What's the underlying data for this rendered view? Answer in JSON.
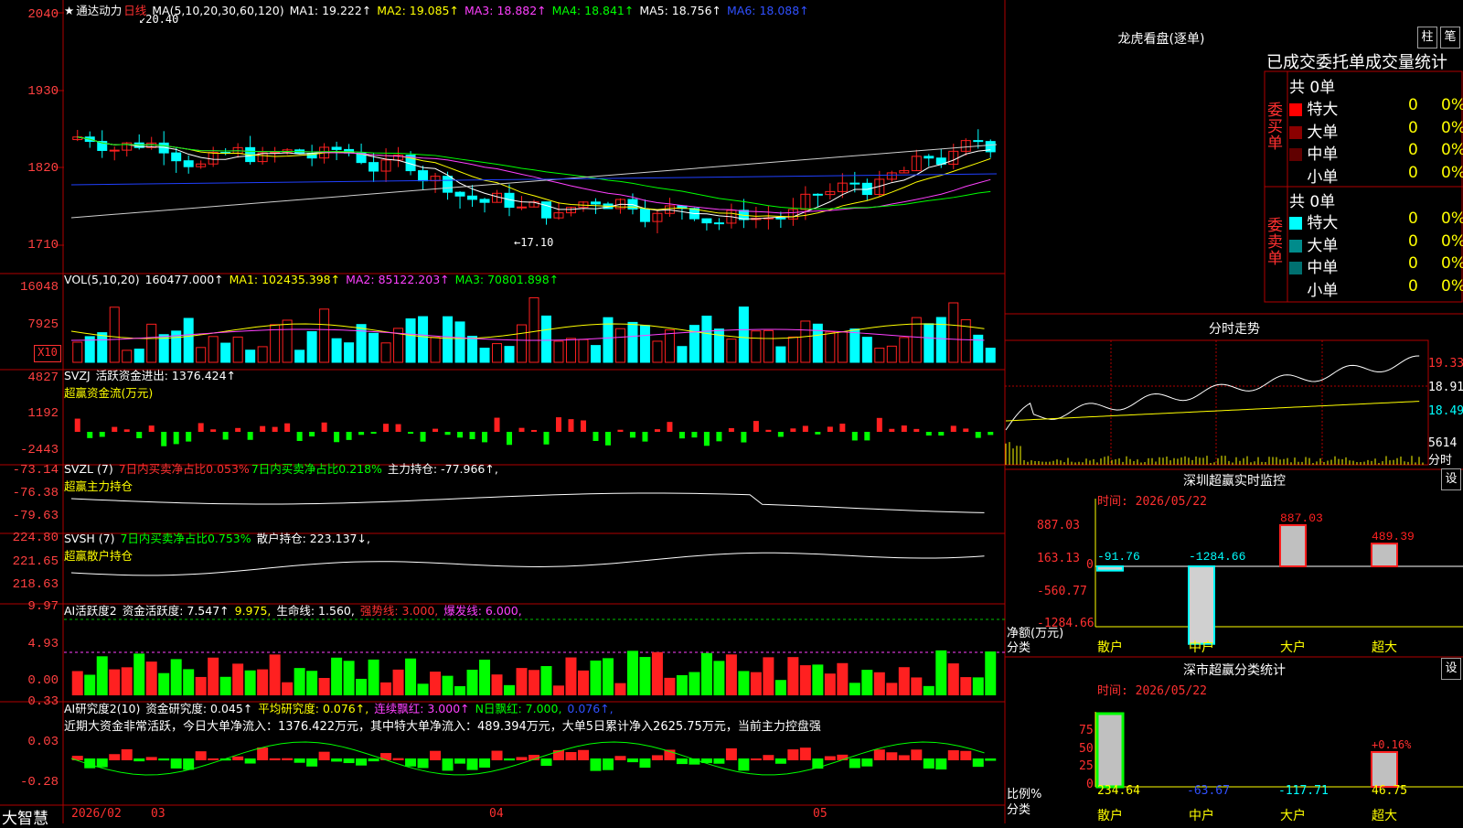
{
  "stock": {
    "star": "★",
    "name": "通达动力",
    "period": "日线"
  },
  "ma_header": {
    "label": "MA(5,10,20,30,60,120)",
    "ma1": "MA1: 19.222↑",
    "ma2": "MA2: 19.085↑",
    "ma3": "MA3: 18.882↑",
    "ma4": "MA4: 18.841↑",
    "ma5": "MA5: 18.756↑",
    "ma6": "MA6: 18.088↑"
  },
  "price_axis": [
    "2040",
    "1930",
    "1820",
    "1710"
  ],
  "price_annotations": {
    "high": "20.40",
    "low": "17.10"
  },
  "vol_header": {
    "label": "VOL(5,10,20)",
    "vol": "160477.000↑",
    "ma1": "MA1: 102435.398↑",
    "ma2": "MA2: 85122.203↑",
    "ma3": "MA3: 70801.898↑"
  },
  "vol_axis": [
    "16048",
    "7925"
  ],
  "vol_unit": "X10",
  "svzj_header": {
    "label": "SVZJ",
    "text": "活跃资金进出: 1376.424↑",
    "sub": "超赢资金流(万元)"
  },
  "svzj_axis": [
    "4827",
    "1192",
    "-2443"
  ],
  "svzl_header": {
    "label": "SVZL (7)",
    "a": "7日内买卖净占比0.053%",
    "b": "7日内买卖净占比0.218%",
    "c": "主力持仓: -77.966↑,",
    "sub": "超赢主力持仓"
  },
  "svzl_axis": [
    "-73.14",
    "-76.38",
    "-79.63"
  ],
  "svsh_header": {
    "label": "SVSH (7)",
    "a": "7日内买卖净占比0.753%",
    "b": "散户持仓: 223.137↓,",
    "sub": "超赢散户持仓"
  },
  "svsh_axis": [
    "224.80",
    "221.65",
    "218.63"
  ],
  "ai1_header": {
    "label": "AI活跃度2",
    "a": "资金活跃度: 7.547↑",
    "b": "9.975,",
    "c": "生命线: 1.560,",
    "d": "强势线: 3.000,",
    "e": "爆发线: 6.000,"
  },
  "ai1_axis": [
    "9.97",
    "4.93",
    "0.00"
  ],
  "ai2_header": {
    "label": "AI研究度2(10)",
    "a": "资金研究度: 0.045↑",
    "b": "平均研究度: 0.076↑,",
    "c": "连续飘红: 3.000↑",
    "d": "N日飘红: 7.000,",
    "e": "0.076↑,"
  },
  "ai2_text": "近期大资金非常活跃，今日大单净流入：1376.422万元，其中特大单净流入：489.394万元，大单5日累计净入2625.75万元，当前主力控盘强",
  "ai2_axis": [
    "0.33",
    "0.03",
    "-0.28"
  ],
  "date_axis": {
    "brand": "大智慧",
    "d1": "2026/02",
    "d2": "03",
    "d3": "04",
    "d4": "05"
  },
  "dragon": {
    "title": "龙虎看盘(逐单)",
    "btn1": "柱",
    "btn2": "笔",
    "subtitle": "已成交委托单成交量统计",
    "buy_label": "委买单",
    "sell_label": "委卖单",
    "buy_total": "共 0单",
    "sell_total": "共 0单",
    "buy_rows": [
      {
        "name": "特大",
        "v": "0",
        "p": "0%",
        "color": "#ff0000"
      },
      {
        "name": "大单",
        "v": "0",
        "p": "0%",
        "color": "#8b0000"
      },
      {
        "name": "中单",
        "v": "0",
        "p": "0%",
        "color": "#600000"
      },
      {
        "name": "小单",
        "v": "0",
        "p": "0%",
        "color": "#000000"
      }
    ],
    "sell_rows": [
      {
        "name": "特大",
        "v": "0",
        "p": "0%",
        "color": "#00ffff"
      },
      {
        "name": "大单",
        "v": "0",
        "p": "0%",
        "color": "#008b8b"
      },
      {
        "name": "中单",
        "v": "0",
        "p": "0%",
        "color": "#007070"
      },
      {
        "name": "小单",
        "v": "0",
        "p": "0%",
        "color": "#000000"
      }
    ]
  },
  "minute": {
    "title": "分时走势",
    "p1": "19.33",
    "p2": "18.91",
    "p3": "18.49",
    "vol": "5614",
    "unit": "分时"
  },
  "monitor": {
    "title": "深圳超赢实时监控",
    "btn": "设",
    "time": "时间: 2026/05/22",
    "axis": [
      "887.03",
      "163.13",
      "0",
      "-560.77",
      "-1284.66"
    ],
    "ylabel": "净额(万元)",
    "xlabel": "分类",
    "cats": [
      "散户",
      "中户",
      "大户",
      "超大"
    ],
    "values": [
      -91.76,
      -1284.66,
      887.03,
      489.39
    ],
    "labels": [
      "-91.76",
      "-1284.66",
      "887.03",
      "489.39"
    ]
  },
  "classify": {
    "title": "深市超赢分类统计",
    "btn": "设",
    "time": "时间: 2026/05/22",
    "axis": [
      "75",
      "50",
      "25",
      "0"
    ],
    "ylabel": "比例%",
    "xlabel": "分类",
    "cats": [
      "散户",
      "中户",
      "大户",
      "超大"
    ],
    "values": [
      "234.64",
      "-63.67",
      "-117.71",
      "46.75"
    ],
    "pct": "+0.16%"
  },
  "colors": {
    "up": "#ff2020",
    "down": "#00ffff",
    "frame": "#b00000"
  }
}
